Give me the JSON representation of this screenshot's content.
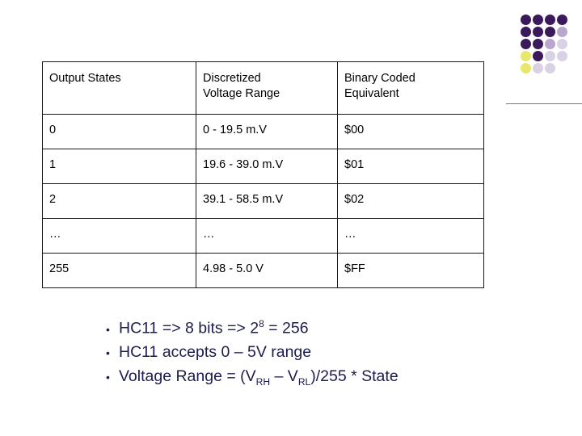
{
  "logo": {
    "colors": {
      "dark": "#3b1a5c",
      "mid": "#6f4a93",
      "light": "#b9a7cf",
      "pale": "#d9d2e4",
      "yellow": "#e7e86a"
    },
    "dots": [
      {
        "row": 0,
        "col": 0,
        "color": "#3b1a5c"
      },
      {
        "row": 0,
        "col": 1,
        "color": "#3b1a5c"
      },
      {
        "row": 0,
        "col": 2,
        "color": "#3b1a5c"
      },
      {
        "row": 0,
        "col": 3,
        "color": "#3b1a5c"
      },
      {
        "row": 1,
        "col": 0,
        "color": "#3b1a5c"
      },
      {
        "row": 1,
        "col": 1,
        "color": "#3b1a5c"
      },
      {
        "row": 1,
        "col": 2,
        "color": "#3b1a5c"
      },
      {
        "row": 1,
        "col": 3,
        "color": "#b9a7cf"
      },
      {
        "row": 2,
        "col": 0,
        "color": "#3b1a5c"
      },
      {
        "row": 2,
        "col": 1,
        "color": "#3b1a5c"
      },
      {
        "row": 2,
        "col": 2,
        "color": "#b9a7cf"
      },
      {
        "row": 2,
        "col": 3,
        "color": "#d9d2e4"
      },
      {
        "row": 3,
        "col": 0,
        "color": "#e7e86a"
      },
      {
        "row": 3,
        "col": 1,
        "color": "#3b1a5c"
      },
      {
        "row": 3,
        "col": 2,
        "color": "#d9d2e4"
      },
      {
        "row": 3,
        "col": 3,
        "color": "#d9d2e4"
      },
      {
        "row": 4,
        "col": 0,
        "color": "#e7e86a"
      },
      {
        "row": 4,
        "col": 1,
        "color": "#d9d2e4"
      },
      {
        "row": 4,
        "col": 2,
        "color": "#d9d2e4"
      }
    ]
  },
  "table": {
    "headers": [
      "Output States",
      "Discretized\nVoltage Range",
      "Binary Coded\nEquivalent"
    ],
    "header_lines": {
      "col1": "Output States",
      "col2_line1": "Discretized",
      "col2_line2": "Voltage Range",
      "col3_line1": "Binary Coded",
      "col3_line2": "Equivalent"
    },
    "rows": [
      {
        "state": "0",
        "range": "0 - 19.5 m.V",
        "binary": "$00"
      },
      {
        "state": "1",
        "range": "19.6 - 39.0 m.V",
        "binary": "$01"
      },
      {
        "state": "2",
        "range": "39.1 - 58.5 m.V",
        "binary": "$02"
      },
      {
        "state": "…",
        "range": "…",
        "binary": "…"
      },
      {
        "state": "255",
        "range": "4.98 - 5.0 V",
        "binary": "$FF"
      }
    ]
  },
  "bullets": {
    "color": "#1c1c4e",
    "marker": "•",
    "items": [
      {
        "id": "bullet-bits",
        "parts": [
          {
            "type": "text",
            "value": "HC11 => 8 bits => 2"
          },
          {
            "type": "sup",
            "value": "8"
          },
          {
            "type": "text",
            "value": " = 256"
          }
        ]
      },
      {
        "id": "bullet-range",
        "parts": [
          {
            "type": "text",
            "value": "HC11 accepts 0 – 5V range"
          }
        ]
      },
      {
        "id": "bullet-formula",
        "parts": [
          {
            "type": "text",
            "value": "Voltage Range = (V"
          },
          {
            "type": "sub",
            "value": "RH"
          },
          {
            "type": "text",
            "value": " – V"
          },
          {
            "type": "sub",
            "value": "RL"
          },
          {
            "type": "text",
            "value": ")/255 * State"
          }
        ]
      }
    ]
  }
}
